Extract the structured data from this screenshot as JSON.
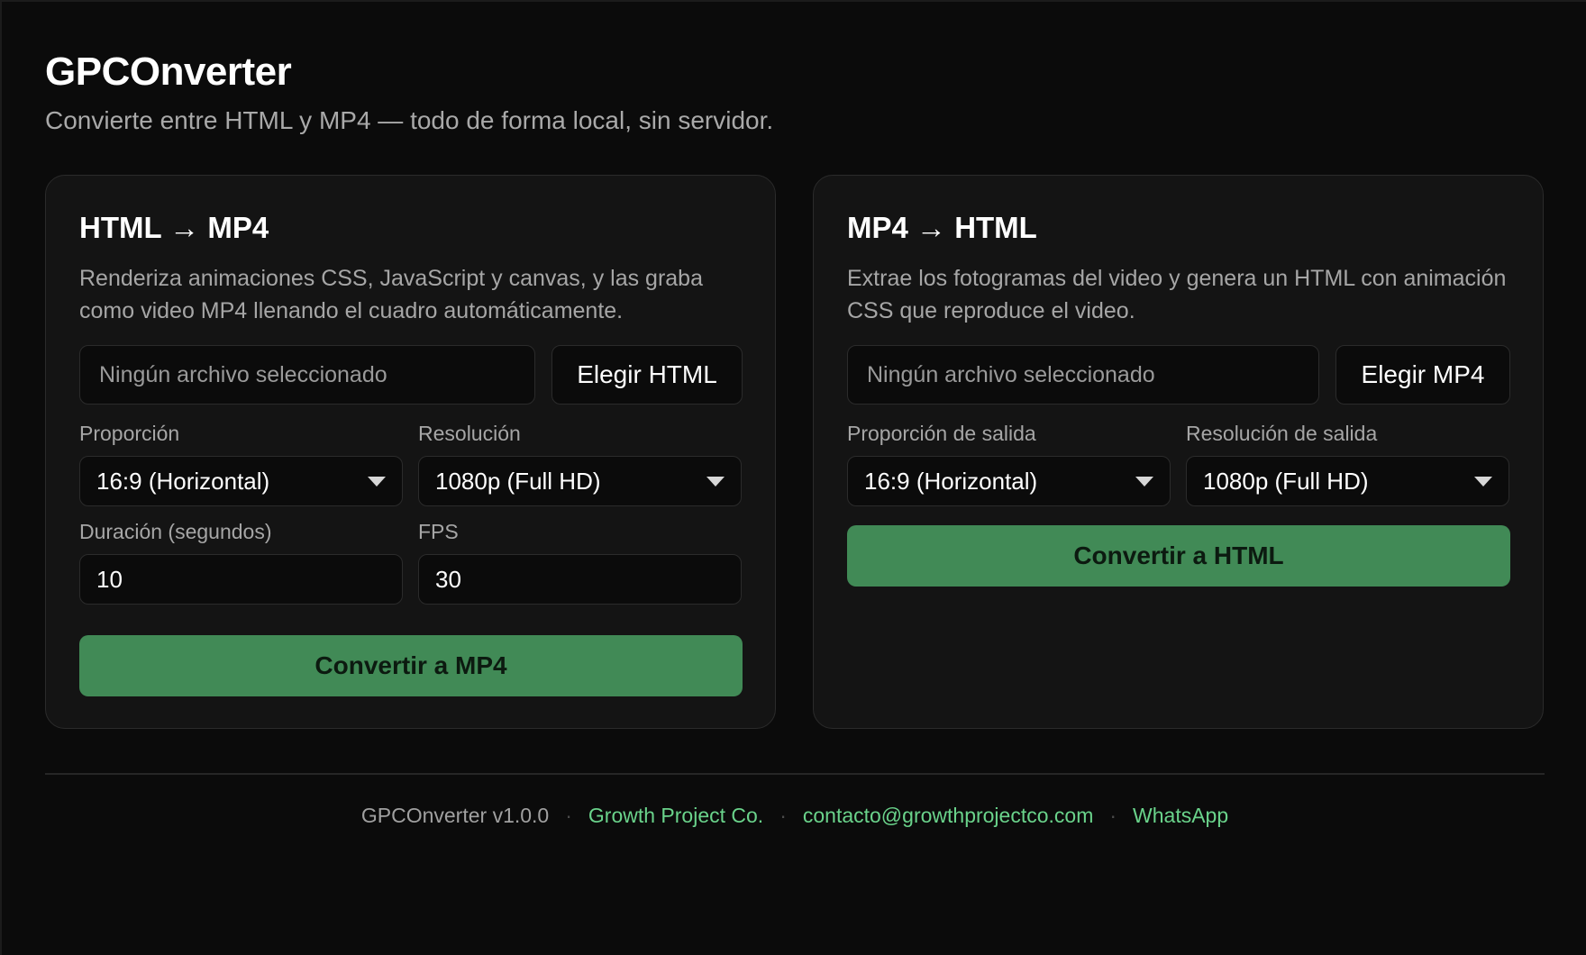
{
  "app": {
    "title": "GPCOnverter",
    "subtitle": "Convierte entre HTML y MP4 — todo de forma local, sin servidor."
  },
  "html_to_mp4": {
    "title": "HTML → MP4",
    "description": "Renderiza animaciones CSS, JavaScript y canvas, y las graba como video MP4 llenando el cuadro automáticamente.",
    "file_placeholder": "Ningún archivo seleccionado",
    "choose_button": "Elegir HTML",
    "aspect_label": "Proporción",
    "aspect_value": "16:9 (Horizontal)",
    "resolution_label": "Resolución",
    "resolution_value": "1080p (Full HD)",
    "duration_label": "Duración (segundos)",
    "duration_value": "10",
    "fps_label": "FPS",
    "fps_value": "30",
    "convert_button": "Convertir a MP4"
  },
  "mp4_to_html": {
    "title": "MP4 → HTML",
    "description": "Extrae los fotogramas del video y genera un HTML con animación CSS que reproduce el video.",
    "file_placeholder": "Ningún archivo seleccionado",
    "choose_button": "Elegir MP4",
    "aspect_label": "Proporción de salida",
    "aspect_value": "16:9 (Horizontal)",
    "resolution_label": "Resolución de salida",
    "resolution_value": "1080p (Full HD)",
    "convert_button": "Convertir a HTML"
  },
  "footer": {
    "version": "GPCOnverter v1.0.0",
    "separator": "·",
    "company_link": "Growth Project Co.",
    "email_link": "contacto@growthprojectco.com",
    "whatsapp_link": "WhatsApp"
  },
  "colors": {
    "background": "#0b0b0b",
    "card": "#141414",
    "accent_button": "#418a56",
    "link": "#6ad38b"
  },
  "icons": {
    "select_caret": "caret-down-icon"
  }
}
